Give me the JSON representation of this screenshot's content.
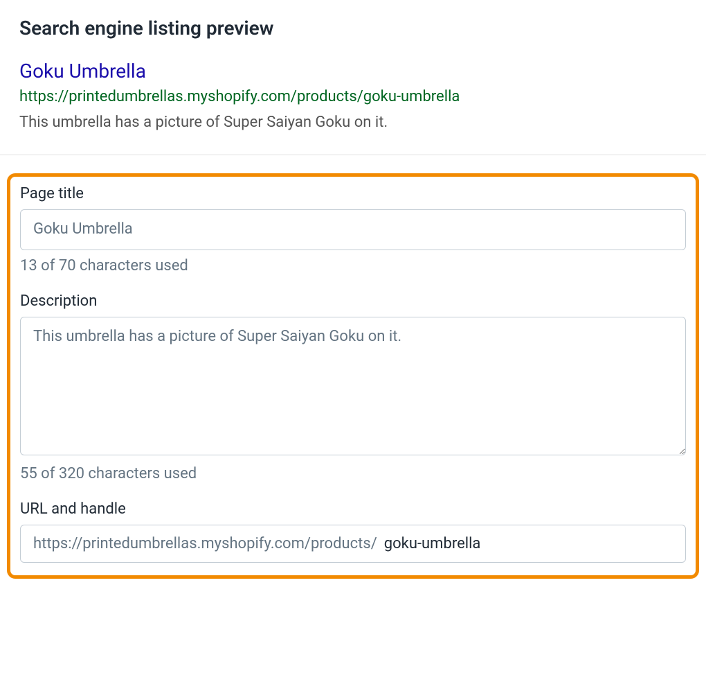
{
  "header": {
    "title": "Search engine listing preview"
  },
  "preview": {
    "title": "Goku Umbrella",
    "url": "https://printedumbrellas.myshopify.com/products/goku-umbrella",
    "description": "This umbrella has a picture of Super Saiyan Goku on it."
  },
  "form": {
    "page_title": {
      "label": "Page title",
      "placeholder": "Goku Umbrella",
      "value": "",
      "char_count": "13 of 70 characters used"
    },
    "description": {
      "label": "Description",
      "placeholder": "This umbrella has a picture of Super Saiyan Goku on it.",
      "value": "",
      "char_count": "55 of 320 characters used"
    },
    "url_handle": {
      "label": "URL and handle",
      "prefix": "https://printedumbrellas.myshopify.com/products/",
      "value": "goku-umbrella"
    }
  }
}
